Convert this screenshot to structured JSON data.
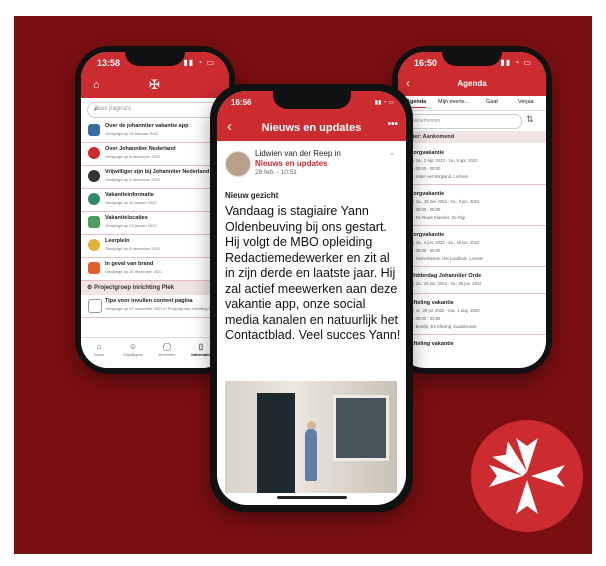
{
  "colors": {
    "background": "#7a0f12",
    "accent": "#cc2b2f",
    "white": "#ffffff"
  },
  "left_phone": {
    "time": "13:58",
    "search_placeholder": "Zoek pagina's",
    "items": [
      {
        "title": "Over de johanniter vakantie app",
        "subtitle": "Gewijzigd op 15 februari 2022"
      },
      {
        "title": "Over Johanniter Nederland",
        "subtitle": "Gewijzigd op 8 december 2021"
      },
      {
        "title": "Vrijwilliger zijn bij Johanniter Nederland",
        "subtitle": "Gewijzigd op 8 december 2021"
      },
      {
        "title": "Vakantieinformatie",
        "subtitle": "Gewijzigd op 20 januari 2022"
      },
      {
        "title": "Vakantielocaties",
        "subtitle": "Gewijzigd op 23 januari 2022"
      },
      {
        "title": "Leerplein",
        "subtitle": "Gewijzigd op 9 december 2021"
      },
      {
        "title": "In geval van brand",
        "subtitle": "Gewijzigd op 15 december 2021"
      }
    ],
    "group": "Projectgroep inrichting Plek",
    "group_item": {
      "title": "Tips voor invullen content pagina",
      "subtitle": "Gewijzigd op 24 november 2021 in Projectgroep inrichting Plek"
    },
    "tabs": [
      {
        "label": "Home",
        "icon": "home-icon"
      },
      {
        "label": "Vrijwilligers",
        "icon": "people-icon"
      },
      {
        "label": "Berichten",
        "icon": "chat-icon"
      },
      {
        "label": "Informatie",
        "icon": "book-icon",
        "active": true
      }
    ]
  },
  "right_phone": {
    "time": "16:50",
    "title": "Agenda",
    "tabs": [
      "Agenda",
      "Mijn evene...",
      "Gaat",
      "Verjaa"
    ],
    "search_placeholder": "evenementen",
    "section": "Fester: Aankomend",
    "events": [
      {
        "title": "Zorgvakantie",
        "date": "za., 2 apr. 2022 - za., 9 apr. 2022",
        "time": "00:00 - 00:00",
        "place": "Hotel Het Borgland, Lochem"
      },
      {
        "title": "Zorgvakantie",
        "date": "za., 28 mei 2022 - za., 3 jun. 2022",
        "time": "00:00 - 00:00",
        "place": "De Ruwe Klandes, De Rijp"
      },
      {
        "title": "Zorgvakantie",
        "date": "za., 4 jun. 2022 - za., 18 jun. 2022",
        "time": "00:00 - 00:00",
        "place": "Hemelsleeve, Het Landhuis, Lemele"
      },
      {
        "title": "Ridderdag Johanniter Orde",
        "date": "za., 25 jun. 2022 - za., 25 jun. 2022",
        "time": "",
        "place": ""
      },
      {
        "title": "Efteling vakantie",
        "date": "vr., 29 jul. 2022 - ma., 1 aug. 2022",
        "time": "00:00 - 23:59",
        "place": "Bosrijk, De Efteling, Kaatsheuvel"
      },
      {
        "title": "Efteling vakantie",
        "date": "",
        "time": "",
        "place": ""
      }
    ]
  },
  "center_phone": {
    "time": "16:56",
    "title": "Nieuws en updates",
    "more": "•••",
    "author": "Lidwien van der Reep in",
    "channel": "Nieuws en updates",
    "date": "28 feb. - 10:51",
    "subject": "Nieuw gezicht",
    "body": "Vandaag is stagiaire Yann Oldenbeuving bij ons gestart. Hij volgt de MBO opleiding Redactiemedewerker en zit al in zijn derde en laatste jaar. Hij zal actief meewerken aan deze vakantie app, onze social media kanalen en natuurlijk het Contactblad. Veel succes Yann!"
  },
  "logo": {
    "icon": "maltese-cross-icon"
  }
}
